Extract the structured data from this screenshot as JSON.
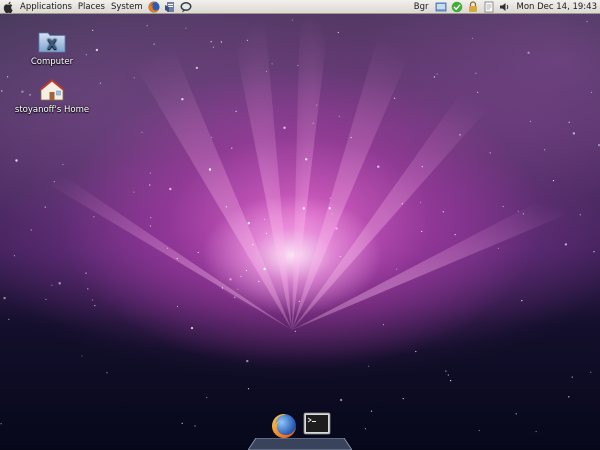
{
  "top_panel": {
    "menus": [
      {
        "label": "Applications"
      },
      {
        "label": "Places"
      },
      {
        "label": "System"
      }
    ],
    "launchers": [
      "firefox-icon",
      "mail-icon",
      "chat-icon"
    ],
    "tray": [
      "network-icon",
      "update-icon",
      "lock-icon",
      "document-icon",
      "volume-icon"
    ],
    "keyboard_layout": "Bgr",
    "clock": "Mon Dec 14, 19:43"
  },
  "desktop": {
    "icons": [
      {
        "label": "Computer",
        "icon": "computer-icon"
      },
      {
        "label": "stoyanoff's Home",
        "icon": "home-folder-icon"
      }
    ]
  },
  "dock": {
    "items": [
      {
        "icon": "firefox-icon"
      },
      {
        "icon": "terminal-icon"
      }
    ]
  },
  "colors": {
    "panel_bg": "#e8e5e0",
    "wallpaper_glow": "#e869cd",
    "wallpaper_dark": "#06081a"
  }
}
